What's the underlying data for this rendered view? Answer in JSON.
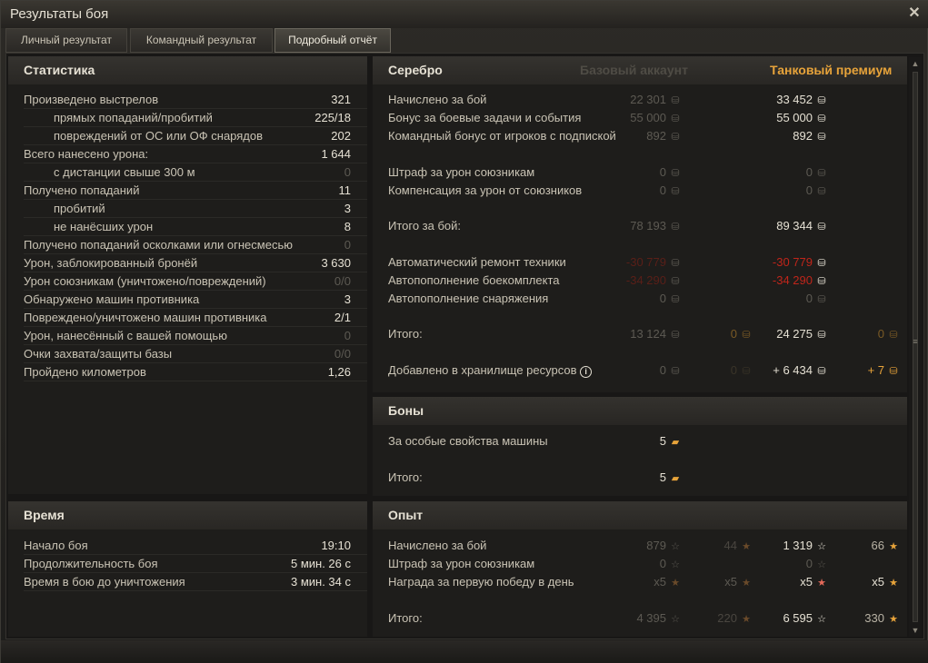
{
  "window": {
    "title": "Результаты боя"
  },
  "tabs": [
    {
      "label": "Личный результат"
    },
    {
      "label": "Командный результат"
    },
    {
      "label": "Подробный отчёт"
    }
  ],
  "stats": {
    "title": "Статистика",
    "rows": [
      {
        "label": "Произведено выстрелов",
        "value": "321"
      },
      {
        "label": "прямых попаданий/пробитий",
        "value": "225/18"
      },
      {
        "label": "повреждений от ОС или ОФ снарядов",
        "value": "202"
      },
      {
        "label": "Всего нанесено урона:",
        "value": "1 644"
      },
      {
        "label": "с дистанции свыше 300 м",
        "value": "0"
      },
      {
        "label": "Получено попаданий",
        "value": "11"
      },
      {
        "label": "пробитий",
        "value": "3"
      },
      {
        "label": "не нанёсших урон",
        "value": "8"
      },
      {
        "label": "Получено попаданий осколками или огнесмесью",
        "value": "0"
      },
      {
        "label": "Урон, заблокированный бронёй",
        "value": "3 630"
      },
      {
        "label": "Урон союзникам (уничтожено/повреждений)",
        "value": "0/0"
      },
      {
        "label": "Обнаружено машин противника",
        "value": "3"
      },
      {
        "label": "Повреждено/уничтожено машин противника",
        "value": "2/1"
      },
      {
        "label": "Урон, нанесённый с вашей помощью",
        "value": "0"
      },
      {
        "label": "Очки захвата/защиты базы",
        "value": "0/0"
      },
      {
        "label": "Пройдено километров",
        "value": "1,26"
      }
    ]
  },
  "time": {
    "title": "Время",
    "rows": [
      {
        "label": "Начало боя",
        "value": "19:10"
      },
      {
        "label": "Продолжительность боя",
        "value": "5 мин. 26 с"
      },
      {
        "label": "Время в бою до уничтожения",
        "value": "3 мин. 34 с"
      }
    ]
  },
  "silver": {
    "title": "Серебро",
    "base_header": "Базовый аккаунт",
    "prem_header": "Танковый премиум",
    "rows": [
      {
        "label": "Начислено за бой",
        "base": "22 301",
        "prem": "33 452"
      },
      {
        "label": "Бонус за боевые задачи и события",
        "base": "55 000",
        "prem": "55 000"
      },
      {
        "label": "Командный бонус от игроков с подпиской",
        "base": "892",
        "prem": "892"
      },
      {
        "label": "Штраф за урон союзникам",
        "base": "0",
        "prem": "0"
      },
      {
        "label": "Компенсация за урон от союзников",
        "base": "0",
        "prem": "0"
      },
      {
        "label": "Итого за бой:",
        "base": "78 193",
        "prem": "89 344"
      },
      {
        "label": "Автоматический ремонт техники",
        "base": "-30 779",
        "prem": "-30 779"
      },
      {
        "label": "Автопополнение боекомплекта",
        "base": "-34 290",
        "prem": "-34 290"
      },
      {
        "label": "Автопополнение снаряжения",
        "base": "0",
        "prem": "0"
      },
      {
        "label": "Итого:",
        "base": "13 124",
        "base_gold": "0",
        "prem": "24 275",
        "prem_gold": "0"
      },
      {
        "label": "Добавлено в хранилище ресурсов",
        "info_icon": "info-icon",
        "base": "0",
        "base_gold": "0",
        "prem": "+ 6 434",
        "prem_gold": "+ 7"
      }
    ]
  },
  "bonds": {
    "title": "Боны",
    "rows": [
      {
        "label": "За особые свойства машины",
        "value": "5"
      },
      {
        "label": "Итого:",
        "value": "5"
      }
    ]
  },
  "xp": {
    "title": "Опыт",
    "rows": [
      {
        "label": "Начислено за бой",
        "base": "879",
        "base_free": "44",
        "prem": "1 319",
        "prem_free": "66"
      },
      {
        "label": "Штраф за урон союзникам",
        "base": "0",
        "prem": "0"
      },
      {
        "label": "Награда за первую победу в день",
        "base": "x5",
        "base_free": "x5",
        "prem": "x5",
        "prem_free": "x5"
      },
      {
        "label": "Итого:",
        "base": "4 395",
        "base_free": "220",
        "prem": "6 595",
        "prem_free": "330"
      }
    ]
  },
  "icons": {
    "credits": "credits-icon",
    "gold": "gold-icon",
    "bond": "bond-icon",
    "xp": "xp-star-icon",
    "free_xp": "free-xp-star-icon"
  },
  "colors": {
    "premium": "#e7a33a",
    "negative": "#c0251a",
    "dim": "#5d5a53"
  }
}
